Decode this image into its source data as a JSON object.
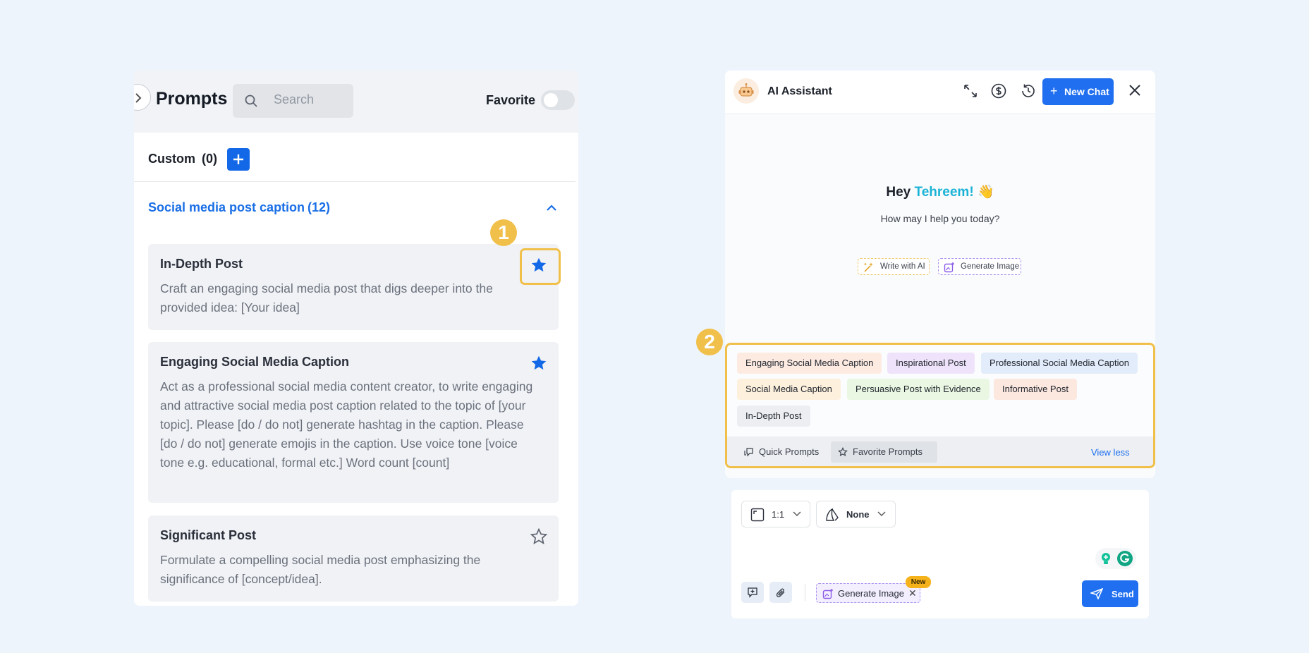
{
  "prompts": {
    "title": "Prompts",
    "search_placeholder": "Search",
    "favorite_label": "Favorite",
    "favorite_on": false,
    "custom_label": "Custom",
    "custom_count": "(0)",
    "category_label": "Social media post caption",
    "category_count": "(12)",
    "cards": [
      {
        "title": "In-Depth Post",
        "desc": "Craft an engaging social media post that digs deeper into the provided idea: [Your idea]",
        "favorite": true
      },
      {
        "title": "Engaging Social Media Caption",
        "desc": "Act as a professional social media content creator, to write engaging and attractive social media post caption related to the topic of [your topic]. Please [do / do not] generate hashtag in the caption. Please [do / do not] generate emojis in the caption. Use voice tone [voice tone e.g. educational, formal etc.] Word count [count]",
        "favorite": true
      },
      {
        "title": "Significant Post",
        "desc": "Formulate a compelling social media post emphasizing the significance of [concept/idea].",
        "favorite": false
      }
    ]
  },
  "badges": {
    "one": "1",
    "two": "2"
  },
  "assistant": {
    "title": "AI Assistant",
    "new_chat_label": "New Chat",
    "greeting_prefix": "Hey ",
    "greeting_name": "Tehreem!",
    "greeting_emoji": "👋",
    "greeting_sub": "How may I help you today?",
    "write_with_ai": "Write with AI",
    "generate_image": "Generate Image",
    "suggestions": [
      {
        "label": "Engaging Social Media Caption",
        "color": "#fdebe2"
      },
      {
        "label": "Inspirational Post",
        "color": "#efe3fb"
      },
      {
        "label": "Professional Social Media Caption",
        "color": "#e3ecfa"
      },
      {
        "label": "Social Media Caption",
        "color": "#fdf0dd"
      },
      {
        "label": "Persuasive Post with Evidence",
        "color": "#eaf8e3"
      },
      {
        "label": "Informative Post",
        "color": "#fde8e0"
      },
      {
        "label": "In-Depth Post",
        "color": "#eceef1"
      }
    ],
    "quick_prompts": "Quick Prompts",
    "favorite_prompts": "Favorite Prompts",
    "view_less": "View less",
    "ratio_value": "1:1",
    "style_value": "None",
    "gen_chip_label": "Generate Image",
    "new_badge": "New",
    "send_label": "Send"
  },
  "colors": {
    "accent": "#1f6ff0",
    "highlight": "#f1c04b"
  }
}
